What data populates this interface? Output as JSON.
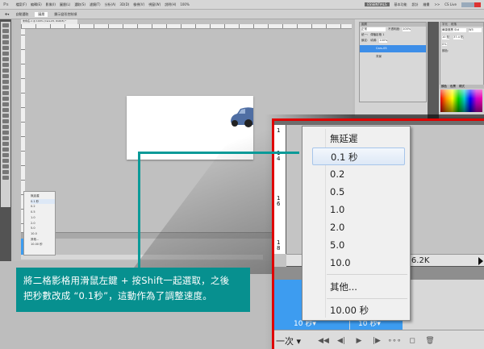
{
  "menubar": {
    "logo": "Ps",
    "items": [
      "檔案(F)",
      "編輯(E)",
      "影像(I)",
      "圖層(L)",
      "選取(S)",
      "濾鏡(T)",
      "分析(A)",
      "3D(D)",
      "檢視(V)",
      "視窗(W)",
      "說明(H)"
    ],
    "zoom": "100%",
    "workspaces": [
      "ESSENTIALS",
      "基本功能",
      "設計",
      "繪畫",
      ">>"
    ],
    "cs_live": "CS Live"
  },
  "optionsbar": {
    "auto_select": "自動選取",
    "auto_select_value": "圖層",
    "show_transform": "顯示變形控制項"
  },
  "document": {
    "tab": "未命名-1 @ 100% (Cars-05, RGB/8) *"
  },
  "layers": {
    "tab": "圖層",
    "blend": "正常",
    "opacity_label": "不透明度:",
    "opacity": "100%",
    "lock": "鎖定:",
    "fill_label": "填滿:",
    "fill": "100%",
    "unify": "統一:",
    "propagate": "傳播影格 1",
    "items": [
      "Cars-05",
      "背景"
    ]
  },
  "character": {
    "tabs": [
      "字元",
      "段落"
    ],
    "font": "華康儷黑 Std",
    "style": "W5",
    "size": "10 點",
    "leading": "37.4 點",
    "tracking": "0%",
    "color_label": "顏色:"
  },
  "swatches": {
    "tabs": [
      "顏色",
      "色票",
      "樣式"
    ]
  },
  "mini_menu": [
    "無延遲",
    "0.1 秒",
    "0.2",
    "0.5",
    "1.0",
    "2.0",
    "5.0",
    "10.0",
    "其他...",
    "10.00 秒"
  ],
  "zoom": {
    "frame_numbers": [
      "1",
      "1 4",
      "1 6",
      "1 8"
    ],
    "status": "56.2K/326.2K",
    "menu": {
      "items": [
        "無延遲",
        "0.1 秒",
        "0.2",
        "0.5",
        "1.0",
        "2.0",
        "5.0",
        "10.0"
      ],
      "selected": "0.1 秒",
      "other": "其他...",
      "last": "10.00 秒"
    },
    "frames": [
      {
        "delay": "10 秒▾"
      },
      {
        "delay": "10 秒▾"
      }
    ],
    "loop": "一次"
  },
  "caption": {
    "line1": "將二格影格用滑鼠左鍵 + 按Shift一起選取，之後",
    "line2": "把秒數改成 “0.1秒”，這動作為了調整速度。"
  },
  "colors": {
    "accent": "#07908f",
    "highlight": "#e00000",
    "frame_blue": "#3d9cf0"
  }
}
